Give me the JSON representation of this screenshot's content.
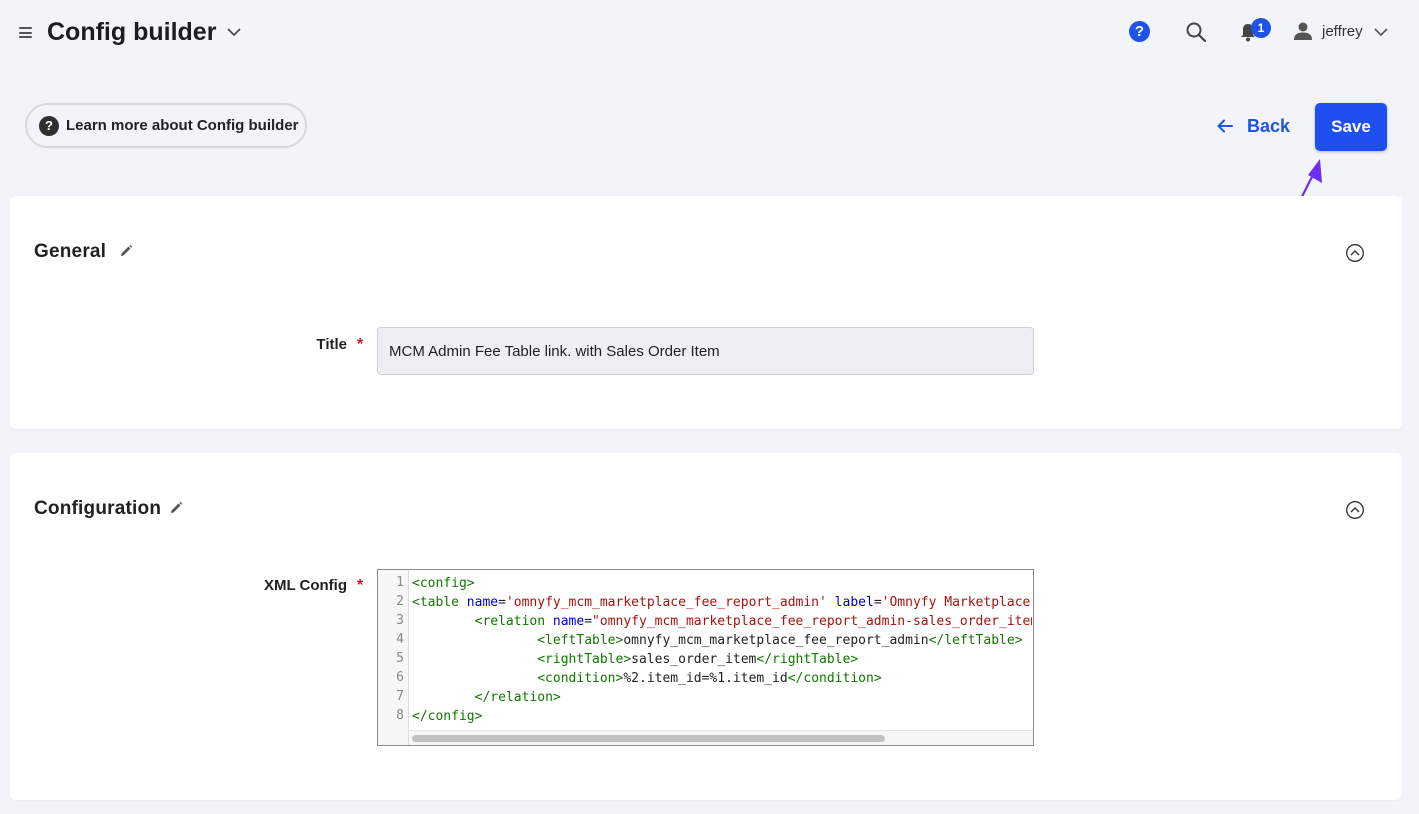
{
  "header": {
    "title": "Config builder",
    "help_icon_glyph": "?",
    "notification_count": "1",
    "user_name": "jeffrey"
  },
  "actions": {
    "learn_more_label": "Learn more about Config builder",
    "back_label": "Back",
    "save_label": "Save"
  },
  "general": {
    "section_title": "General",
    "title_label": "Title",
    "required_mark": "*",
    "title_value": "MCM Admin Fee Table link. with Sales Order Item"
  },
  "configuration": {
    "section_title": "Configuration",
    "xml_label": "XML Config",
    "required_mark": "*",
    "line_numbers": [
      "1",
      "2",
      "3",
      "4",
      "5",
      "6",
      "7",
      "8"
    ],
    "xml_lines": [
      "<config>",
      "<table name='omnyfy_mcm_marketplace_fee_report_admin' label='Omnyfy Marketplace Fee Report Admin'>",
      "        <relation name=\"omnyfy_mcm_marketplace_fee_report_admin-sales_order_item\">",
      "                <leftTable>omnyfy_mcm_marketplace_fee_report_admin</leftTable>",
      "                <rightTable>sales_order_item</rightTable>",
      "                <condition>%2.item_id=%1.item_id</condition>",
      "        </relation>",
      "</config>"
    ]
  },
  "colors": {
    "accent": "#1f4ff0",
    "annotation_arrow": "#6a2ff0",
    "required": "#d3132b"
  },
  "icons": [
    "menu-icon",
    "chevron-down-icon",
    "help-icon",
    "search-icon",
    "bell-icon",
    "user-icon",
    "question-icon",
    "arrow-left-icon",
    "pencil-icon",
    "collapse-up-icon"
  ]
}
